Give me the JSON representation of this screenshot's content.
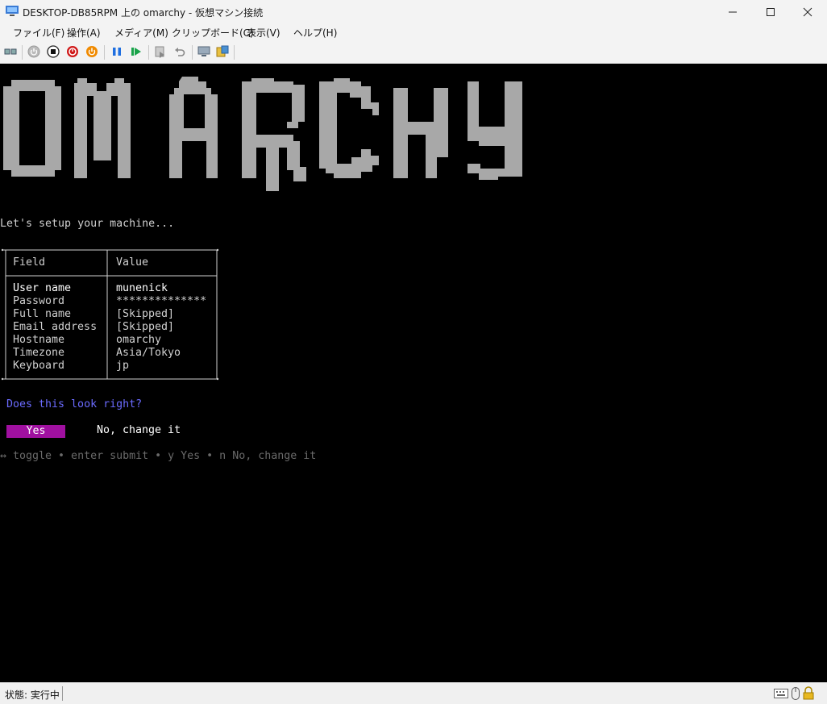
{
  "window": {
    "title": "DESKTOP-DB85RPM 上の omarchy - 仮想マシン接続"
  },
  "menu": [
    "ファイル(F)",
    "操作(A)",
    "メディア(M)",
    "クリップボード(C)",
    "表示(V)",
    "ヘルプ(H)"
  ],
  "toolbar": {
    "icons": [
      "ctrl-alt-del-icon",
      "start-icon",
      "turn-off-icon",
      "shut-down-icon",
      "power-icon",
      "pause-icon",
      "resume-icon",
      "checkpoint-icon",
      "revert-icon",
      "enhanced-session-icon",
      "share-icon"
    ]
  },
  "terminal": {
    "logo_text": "omarchy",
    "intro": "Let's setup your machine...",
    "table": {
      "headers": [
        "Field",
        "Value"
      ],
      "rows": [
        {
          "field": "User name",
          "value": "munenick"
        },
        {
          "field": "Password",
          "value": "**************"
        },
        {
          "field": "Full name",
          "value": "[Skipped]"
        },
        {
          "field": "Email address",
          "value": "[Skipped]"
        },
        {
          "field": "Hostname",
          "value": "omarchy"
        },
        {
          "field": "Timezone",
          "value": "Asia/Tokyo"
        },
        {
          "field": "Keyboard",
          "value": "jp"
        }
      ]
    },
    "question": "Does this look right?",
    "yes_label": "Yes",
    "no_label": "No, change it",
    "hint": "↔ toggle • enter submit • y Yes • n No, change it"
  },
  "statusbar": {
    "status": "状態: 実行中"
  },
  "colors": {
    "terminal_bg": "#000000",
    "logo": "#a8a8a8",
    "question": "#6b6bff",
    "yes_bg": "#a010a0",
    "hint": "#6a6a6a"
  }
}
